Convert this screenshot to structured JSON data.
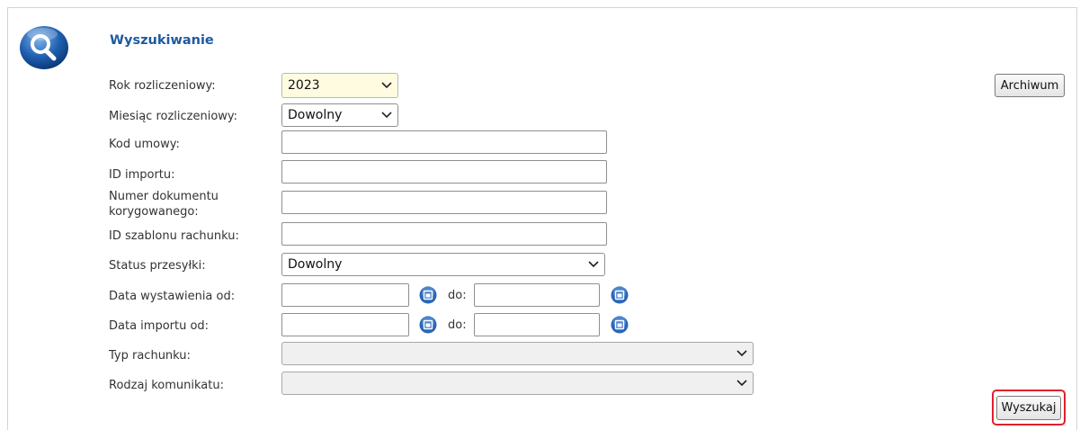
{
  "title": "Wyszukiwanie",
  "archive_button": "Archiwum",
  "search_button": "Wyszukaj",
  "fields": {
    "rok": {
      "label": "Rok rozliczeniowy:",
      "value": "2023"
    },
    "miesiac": {
      "label": "Miesiąc rozliczeniowy:",
      "value": "Dowolny"
    },
    "kod_umowy": {
      "label": "Kod umowy:",
      "value": ""
    },
    "id_importu": {
      "label": "ID importu:",
      "value": ""
    },
    "numer_dok": {
      "label_line1": "Numer dokumentu",
      "label_line2": "korygowanego:",
      "value": ""
    },
    "id_szablonu": {
      "label": "ID szablonu rachunku:",
      "value": ""
    },
    "status": {
      "label": "Status przesyłki:",
      "value": "Dowolny"
    },
    "data_wyst": {
      "label": "Data wystawienia od:",
      "to_label": "do:",
      "from": "",
      "to": ""
    },
    "data_imp": {
      "label": "Data importu od:",
      "to_label": "do:",
      "from": "",
      "to": ""
    },
    "typ": {
      "label": "Typ rachunku:",
      "value": ""
    },
    "rodzaj": {
      "label": "Rodzaj komunikatu:",
      "value": ""
    }
  },
  "colors": {
    "title": "#1d5aa0",
    "highlight": "#e0202e",
    "year_select_bg": "#fffbe0"
  },
  "icons": [
    "search-logo-icon",
    "calendar-icon",
    "chevron-down-icon"
  ]
}
